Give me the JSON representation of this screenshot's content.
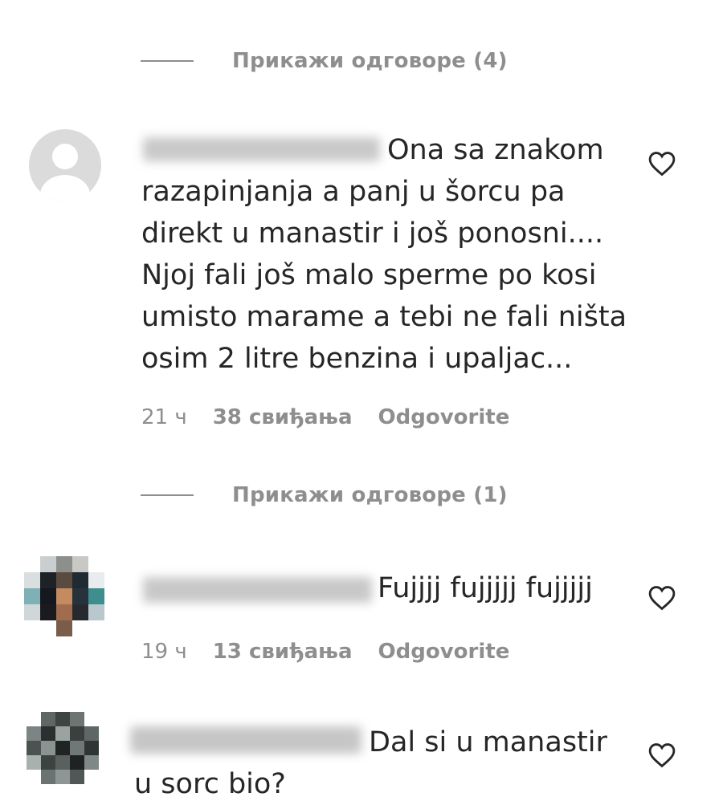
{
  "comments": [
    {
      "replies_link": "Прикажи одговоре (4)"
    },
    {
      "text": "Ona sa znakom razapinjanja a panj u šorcu pa direkt u manastir i još ponosni.... Njoj fali još malo sperme po kosi umisto marame a tebi ne fali ništa osim 2 litre benzina i upaljac...",
      "lines": [
        "Ona sa znakom",
        "razapinjanja a panj u šorcu pa",
        "direkt u manastir i još ponosni....",
        "Njoj fali još malo sperme po kosi",
        "umisto marame a tebi ne fali ništa",
        "osim 2 litre benzina i upaljac..."
      ],
      "time": "21 ч",
      "likes": "38 свиђања",
      "reply": "Odgovorite",
      "replies_link": "Прикажи одговоре (1)"
    },
    {
      "text": "Fujjjj fujjjjj fujjjjj",
      "time": "19 ч",
      "likes": "13 свиђања",
      "reply": "Odgovorite"
    },
    {
      "lines": [
        "Dal si u manastir",
        "u sorc bio?"
      ]
    }
  ],
  "icons": {
    "like": "heart-outline-icon",
    "avatar_placeholder": "default-user-avatar-icon"
  },
  "colors": {
    "text": "#262626",
    "secondary": "#8e8e8e",
    "placeholder_avatar": "#dbdbdb"
  }
}
